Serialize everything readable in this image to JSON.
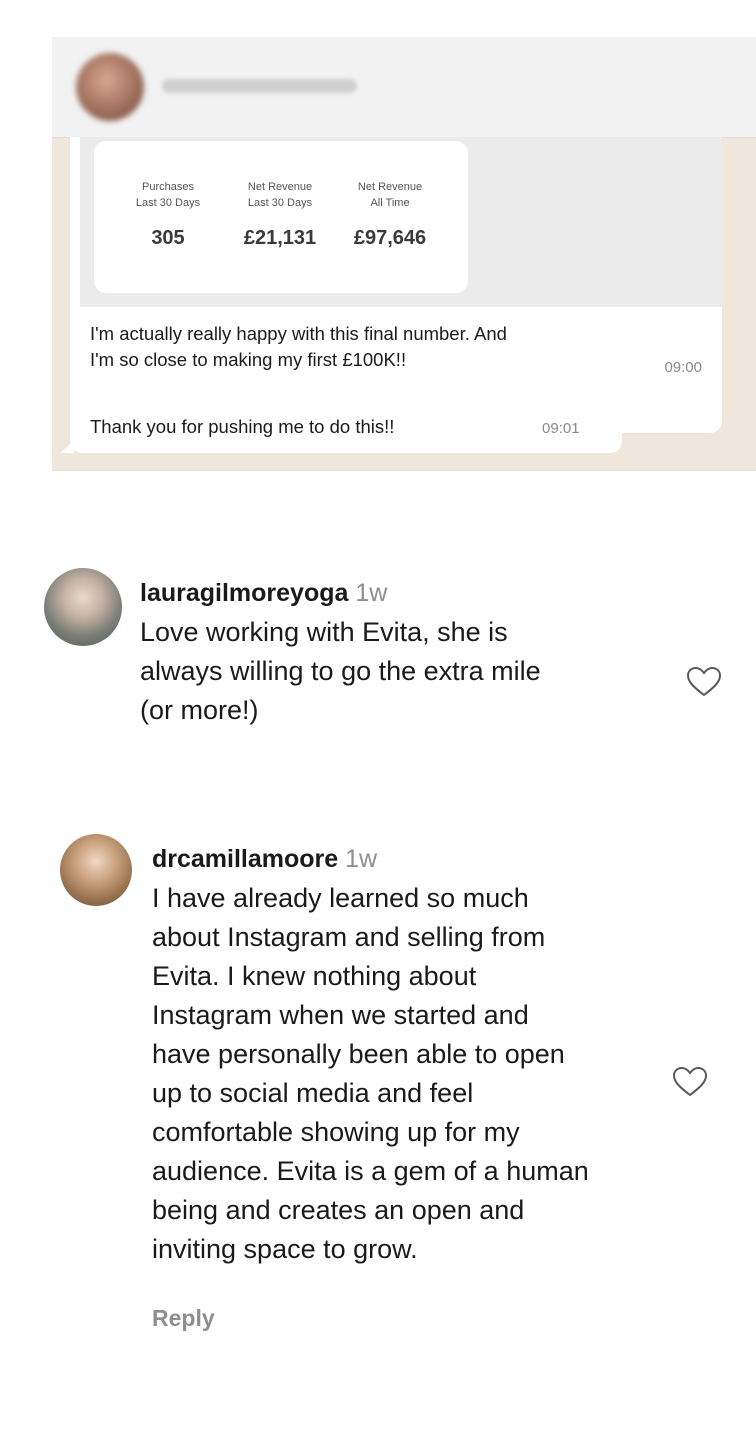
{
  "whatsapp": {
    "stats": [
      {
        "label_line1": "Purchases",
        "label_line2": "Last 30 Days",
        "value": "305"
      },
      {
        "label_line1": "Net Revenue",
        "label_line2": "Last 30 Days",
        "value": "£21,131"
      },
      {
        "label_line1": "Net Revenue",
        "label_line2": "All Time",
        "value": "£97,646"
      }
    ],
    "message1_line1": "I'm actually really happy with this final number. And",
    "message1_line2": "I'm so close to making my first £100K!!",
    "message1_time": "09:00",
    "message2": "Thank you for pushing me to do this!!",
    "message2_time": "09:01"
  },
  "comments": [
    {
      "username": "lauragilmoreyoga",
      "time": "1w",
      "lines": [
        "Love working with Evita, she is",
        "always willing to go the extra mile",
        "(or more!)"
      ]
    },
    {
      "username": "drcamillamoore",
      "time": "1w",
      "lines": [
        "I have already learned so much",
        "about Instagram and selling from",
        "Evita. I knew nothing about",
        "Instagram when we started and",
        "have personally been able to open",
        "up to social media and feel",
        "comfortable showing up for my",
        "audience. Evita is a gem of a human",
        "being and creates an open and",
        "inviting space to grow."
      ],
      "reply_label": "Reply"
    }
  ],
  "icons": {
    "like": "heart-outline-icon"
  }
}
